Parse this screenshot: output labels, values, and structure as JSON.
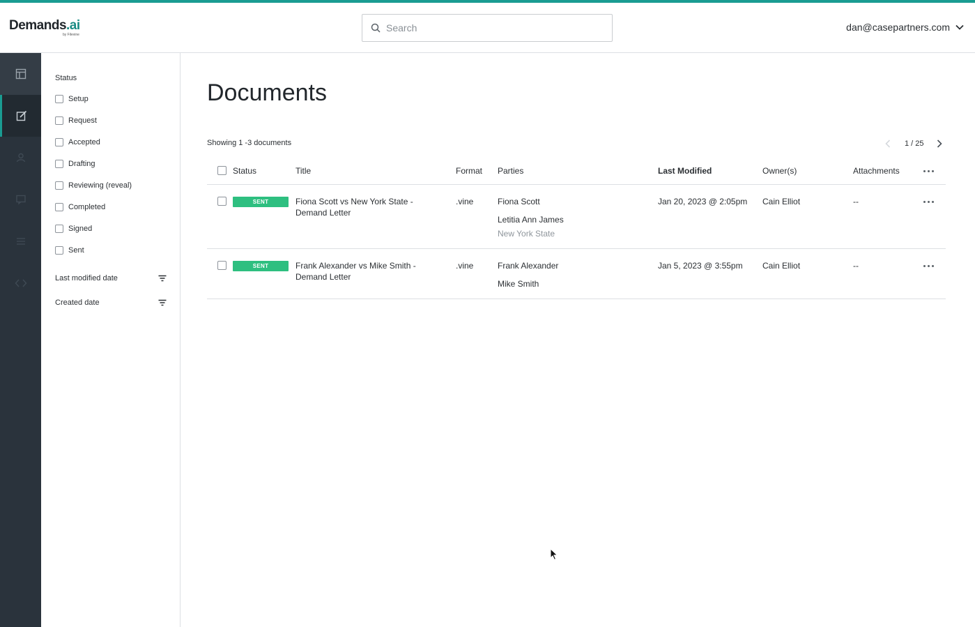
{
  "app": {
    "logo_text": "Demands",
    "logo_ai": ".ai",
    "logo_sub": "by Filevine"
  },
  "header": {
    "search_placeholder": "Search",
    "user_email": "dan@casepartners.com"
  },
  "rail": {
    "items": [
      "layout-icon",
      "edit-icon",
      "user-icon",
      "chat-icon",
      "list-icon",
      "code-icon"
    ]
  },
  "filters": {
    "status_label": "Status",
    "options": [
      "Setup",
      "Request",
      "Accepted",
      "Drafting",
      "Reviewing (reveal)",
      "Completed",
      "Signed",
      "Sent"
    ],
    "last_modified_label": "Last modified date",
    "created_label": "Created date"
  },
  "main": {
    "title": "Documents",
    "showing": "Showing 1 -3 documents",
    "pager": "1 / 25"
  },
  "table": {
    "headers": {
      "status": "Status",
      "title": "Title",
      "format": "Format",
      "parties": "Parties",
      "last_modified": "Last Modified",
      "owners": "Owner(s)",
      "attachments": "Attachments"
    },
    "rows": [
      {
        "status": "SENT",
        "title_line1": "Fiona Scott vs New York State -",
        "title_line2": "Demand Letter",
        "format": ".vine",
        "party1": "Fiona Scott",
        "party2": "Letitia Ann James",
        "party3": "New York State",
        "last_modified": "Jan 20, 2023 @ 2:05pm",
        "owner": "Cain Elliot",
        "attachments": "--"
      },
      {
        "status": "SENT",
        "title_line1": "Frank Alexander vs Mike Smith -",
        "title_line2": "Demand Letter",
        "format": ".vine",
        "party1": "Frank Alexander",
        "party2": "Mike Smith",
        "last_modified": "Jan 5, 2023 @ 3:55pm",
        "owner": "Cain Elliot",
        "attachments": "--"
      }
    ]
  },
  "colors": {
    "accent": "#1a9c92",
    "sent_badge": "#2ebf80",
    "rail_bg": "#2a333c"
  }
}
